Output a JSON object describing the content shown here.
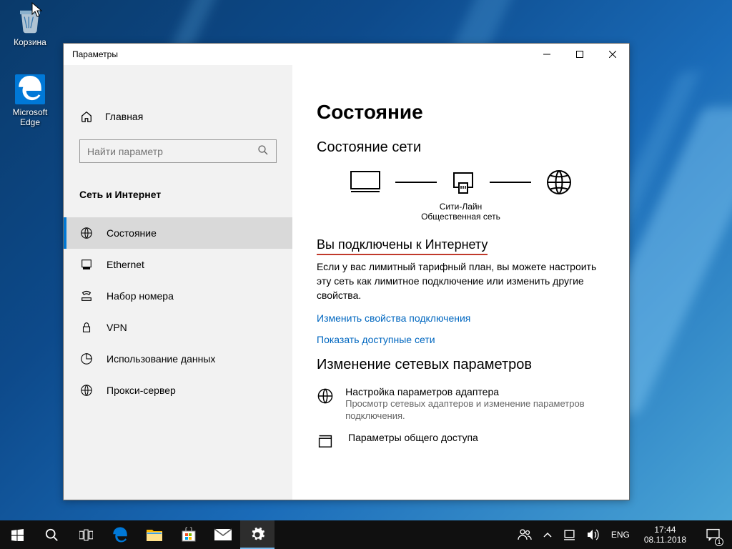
{
  "desktop": {
    "icons": [
      {
        "name": "recycle-bin",
        "label": "Корзина"
      },
      {
        "name": "edge",
        "label": "Microsoft\nEdge"
      }
    ]
  },
  "window": {
    "title": "Параметры"
  },
  "sidebar": {
    "home": "Главная",
    "search_placeholder": "Найти параметр",
    "category": "Сеть и Интернет",
    "items": [
      {
        "label": "Состояние",
        "selected": true
      },
      {
        "label": "Ethernet"
      },
      {
        "label": "Набор номера"
      },
      {
        "label": "VPN"
      },
      {
        "label": "Использование данных"
      },
      {
        "label": "Прокси-сервер"
      }
    ]
  },
  "main": {
    "heading": "Состояние",
    "section1": "Состояние сети",
    "network_name": "Сити-Лайн",
    "network_type": "Общественная сеть",
    "connected_heading": "Вы подключены к Интернету",
    "connected_body": "Если у вас лимитный тарифный план, вы можете настроить эту сеть как лимитное подключение или изменить другие свойства.",
    "link1": "Изменить свойства подключения",
    "link2": "Показать доступные сети",
    "section2": "Изменение сетевых параметров",
    "opt1_title": "Настройка параметров адаптера",
    "opt1_body": "Просмотр сетевых адаптеров и изменение параметров подключения.",
    "opt2_title": "Параметры общего доступа"
  },
  "taskbar": {
    "lang": "ENG",
    "time": "17:44",
    "date": "08.11.2018",
    "notif_count": "1"
  }
}
